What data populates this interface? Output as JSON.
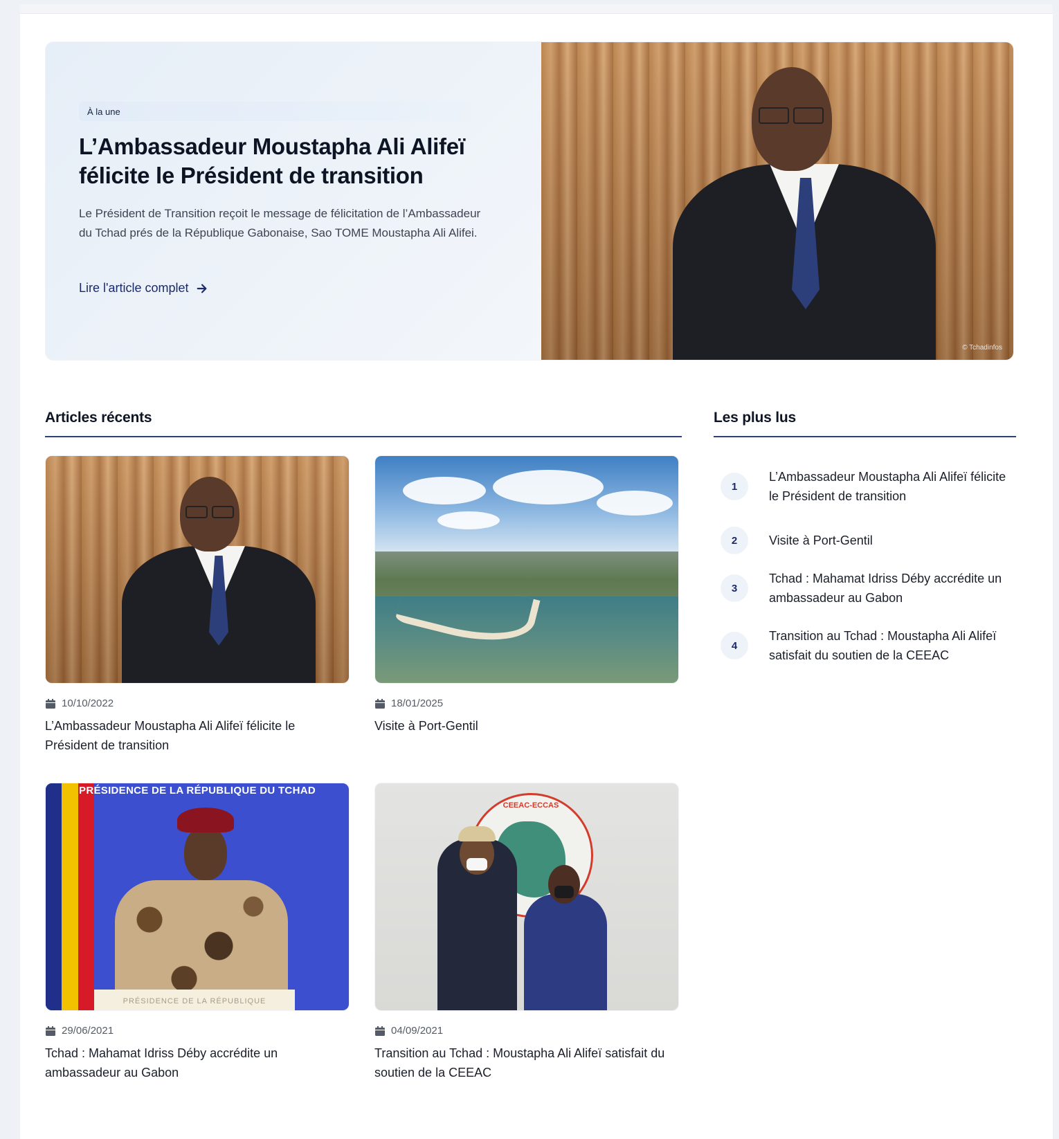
{
  "hero": {
    "badge": "À la une",
    "title": "L’Ambassadeur Moustapha Ali Alifeï félicite le Président de transition",
    "excerpt": "Le Président de Transition reçoit le message de félicitation de l’Ambassadeur du Tchad prés de la République Gabonaise, Sao TOME Moustapha Ali Alifei.",
    "link_label": "Lire l'article complet",
    "image_credit": "© Tchadinfos"
  },
  "recent": {
    "heading": "Articles récents",
    "articles": [
      {
        "date": "10/10/2022",
        "title": "L’Ambassadeur Moustapha Ali Alifeï félicite le Président de transition"
      },
      {
        "date": "18/01/2025",
        "title": "Visite à Port-Gentil"
      },
      {
        "date": "29/06/2021",
        "title": "Tchad : Mahamat Idriss Déby accrédite un ambassadeur au Gabon"
      },
      {
        "date": "04/09/2021",
        "title": "Transition au Tchad : Moustapha Ali Alifeï satisfait du soutien de la CEEAC"
      }
    ],
    "image_texts": {
      "presidency_banner": "PRÉSIDENCE DE LA RÉPUBLIQUE DU TCHAD",
      "podium": "PRÉSIDENCE DE LA RÉPUBLIQUE",
      "ceeac": "CEEAC-ECCAS"
    }
  },
  "most_read": {
    "heading": "Les plus lus",
    "items": [
      {
        "rank": "1",
        "title": "L’Ambassadeur Moustapha Ali Alifeï félicite le Président de transition"
      },
      {
        "rank": "2",
        "title": "Visite à Port-Gentil"
      },
      {
        "rank": "3",
        "title": "Tchad : Mahamat Idriss Déby accrédite un ambassadeur au Gabon"
      },
      {
        "rank": "4",
        "title": "Transition au Tchad : Moustapha Ali Alifeï satisfait du soutien de la CEEAC"
      }
    ]
  },
  "icons": {
    "calendar": "calendar-icon",
    "arrow": "arrow-right-icon"
  },
  "colors": {
    "accent": "#1b2a6b",
    "rule": "#2b3f78",
    "hero_bg": "#e8f0f8"
  }
}
